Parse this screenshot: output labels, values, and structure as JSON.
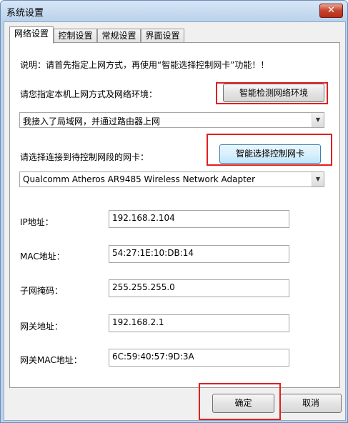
{
  "window": {
    "title": "系统设置",
    "close_label": "✕"
  },
  "tabs": [
    {
      "label": "网络设置",
      "active": true
    },
    {
      "label": "控制设置",
      "active": false
    },
    {
      "label": "常规设置",
      "active": false
    },
    {
      "label": "界面设置",
      "active": false
    }
  ],
  "network": {
    "note": "说明：请首先指定上网方式，再使用“智能选择控制网卡”功能！！",
    "mode_label": "请您指定本机上网方式及网络环境：",
    "detect_button": "智能检测网络环境",
    "mode_value": "我接入了局域网，并通过路由器上网",
    "adapter_label": "请选择连接到待控制网段的网卡：",
    "select_button": "智能选择控制网卡",
    "adapter_value": "Qualcomm Atheros AR9485 Wireless Network Adapter",
    "fields": [
      {
        "label": "IP地址：",
        "value": "192.168.2.104"
      },
      {
        "label": "MAC地址：",
        "value": "54:27:1E:10:DB:14"
      },
      {
        "label": "子网掩码：",
        "value": "255.255.255.0"
      },
      {
        "label": "网关地址：",
        "value": "192.168.2.1"
      },
      {
        "label": "网关MAC地址：",
        "value": "6C:59:40:57:9D:3A"
      }
    ]
  },
  "footer": {
    "ok_button": "确定",
    "cancel_button": "取消"
  },
  "colors": {
    "highlight": "#e02020",
    "accent": "#3c7fb1"
  },
  "icons": {
    "dropdown": "chevron-down-icon",
    "close": "close-icon"
  }
}
